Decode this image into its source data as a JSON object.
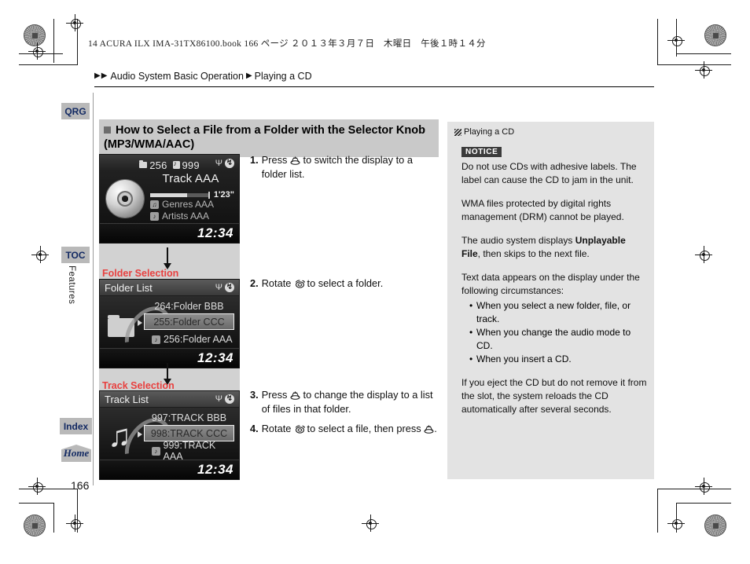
{
  "print_slug": "14 ACURA ILX IMA-31TX86100.book   166 ページ   ２０１３年３月７日　木曜日　午後１時１４分",
  "breadcrumb": {
    "arrow1": "▶",
    "arrow2": "▶",
    "level1": "Audio System Basic Operation",
    "arrow_mid": "▶",
    "level2": "Playing a CD"
  },
  "tabs": {
    "qrg": "QRG",
    "toc": "TOC",
    "features": "Features",
    "index": "Index",
    "home": "Home"
  },
  "section": {
    "title_line1": "How to Select a File from a Folder with the Selector Knob",
    "title_line2": "(MP3/WMA/AAC)"
  },
  "screens": {
    "now_playing": {
      "folder_number": "256",
      "track_number": "999",
      "track_title": "Track AAA",
      "elapsed_time": "1'23\"",
      "genre": "Genres AAA",
      "artist": "Artists AAA",
      "clock": "12:34",
      "usb_icon": "usb-icon",
      "bluetooth_icon": "bluetooth-icon",
      "disc_icon": "cd-disc-icon"
    },
    "folder_selection": {
      "caption": "Folder Selection",
      "header": "Folder List",
      "rows": [
        {
          "label": "264:Folder BBB",
          "selected": false,
          "has_icon": false
        },
        {
          "label": "255:Folder CCC",
          "selected": true,
          "has_icon": false
        },
        {
          "label": "256:Folder AAA",
          "selected": false,
          "has_icon": true
        }
      ],
      "clock": "12:34",
      "icon": "folder-icon"
    },
    "track_selection": {
      "caption": "Track Selection",
      "header": "Track List",
      "rows": [
        {
          "label": "997:TRACK BBB",
          "selected": false,
          "has_icon": false
        },
        {
          "label": "998:TRACK CCC",
          "selected": true,
          "has_icon": false
        },
        {
          "label": "999:TRACK AAA",
          "selected": false,
          "has_icon": true
        }
      ],
      "clock": "12:34",
      "icon": "music-note-icon"
    }
  },
  "steps": [
    {
      "num": "1.",
      "pre": "Press",
      "icon": "selector-knob-press-icon",
      "post": "to switch the display to a folder list."
    },
    {
      "num": "2.",
      "pre": "Rotate",
      "icon": "selector-knob-rotate-icon",
      "post": "to select a folder."
    },
    {
      "num": "3.",
      "pre": "Press",
      "icon": "selector-knob-press-icon",
      "post": "to change the display to a list of files in that folder."
    },
    {
      "num": "4.",
      "pre": "Rotate",
      "icon": "selector-knob-rotate-icon",
      "post": "to select a file, then press",
      "icon2": "selector-knob-press-icon",
      "post2": "."
    }
  ],
  "note_panel": {
    "title": "Playing a CD",
    "notice_tag": "NOTICE",
    "notice_text": "Do not use CDs with adhesive labels. The label can cause the CD to jam in the unit.",
    "para_drm": "WMA files protected by digital rights management (DRM) cannot be played.",
    "para_unplayable_pre": "The audio system displays ",
    "para_unplayable_bold": "Unplayable File",
    "para_unplayable_post": ", then skips to the next file.",
    "para_textdata": "Text data appears on the display under the following circumstances:",
    "bullets": [
      "When you select a new folder, file, or track.",
      "When you change the audio mode to CD.",
      "When you insert a CD."
    ],
    "para_eject": "If you eject the CD but do not remove it from the slot, the system reloads the CD automatically after several seconds."
  },
  "page_number": "166",
  "colors": {
    "caption_red": "#e8403f",
    "tab_blue": "#132a63",
    "tab_gray": "#b9b9b9",
    "title_bar": "#c9c9c9",
    "note_panel": "#e3e3e3"
  }
}
